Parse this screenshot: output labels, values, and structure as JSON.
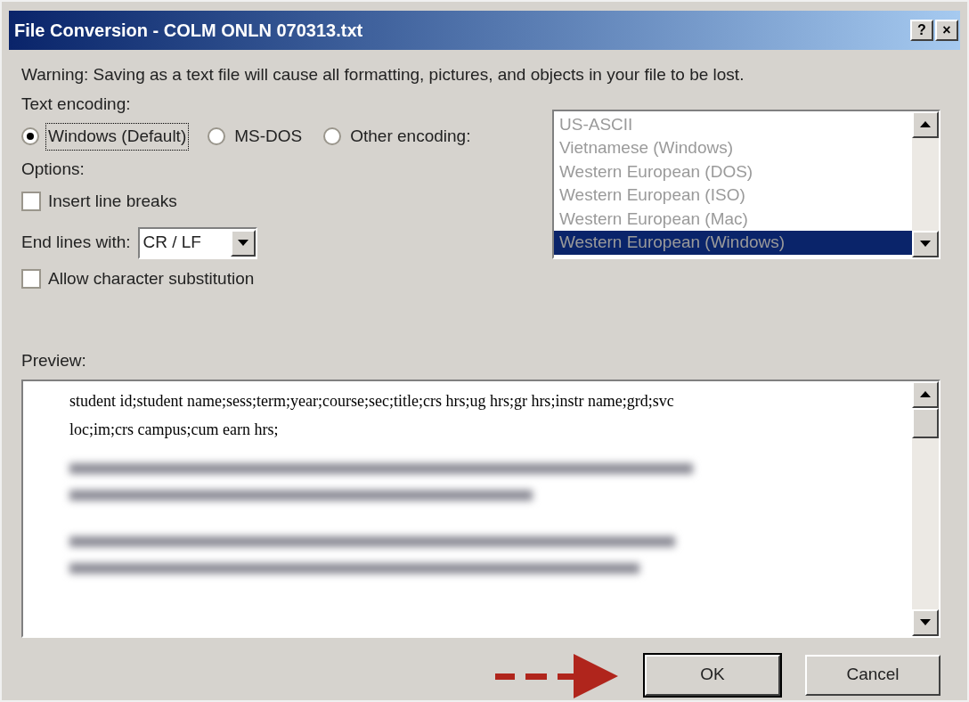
{
  "window": {
    "title": "File Conversion - COLM ONLN 070313.txt",
    "buttons": [
      "?",
      "×"
    ]
  },
  "warning": "Warning: Saving as a text file will cause all formatting, pictures, and objects in your file to be lost.",
  "text_encoding": {
    "label": "Text encoding:",
    "options": [
      {
        "label": "Windows (Default)",
        "selected": true
      },
      {
        "label": "MS-DOS",
        "selected": false
      },
      {
        "label": "Other encoding:",
        "selected": false
      }
    ]
  },
  "encoding_list": {
    "disabled": true,
    "items": [
      {
        "label": "US-ASCII",
        "selected": false
      },
      {
        "label": "Vietnamese (Windows)",
        "selected": false
      },
      {
        "label": "Western European (DOS)",
        "selected": false
      },
      {
        "label": "Western European (ISO)",
        "selected": false
      },
      {
        "label": "Western European (Mac)",
        "selected": false
      },
      {
        "label": "Western European (Windows)",
        "selected": true
      }
    ]
  },
  "options": {
    "label": "Options:",
    "insert_line_breaks": {
      "label": "Insert line breaks",
      "checked": false
    },
    "end_lines": {
      "label": "End lines with:",
      "value": "CR / LF"
    },
    "allow_substitution": {
      "label": "Allow character substitution",
      "checked": false
    }
  },
  "preview": {
    "label": "Preview:",
    "text": "student id;student name;sess;term;year;course;sec;title;crs hrs;ug hrs;gr hrs;instr name;grd;svc loc;im;crs campus;cum earn hrs;"
  },
  "buttons": [
    {
      "label": "OK",
      "highlighted": true
    },
    {
      "label": "Cancel",
      "highlighted": false
    }
  ]
}
